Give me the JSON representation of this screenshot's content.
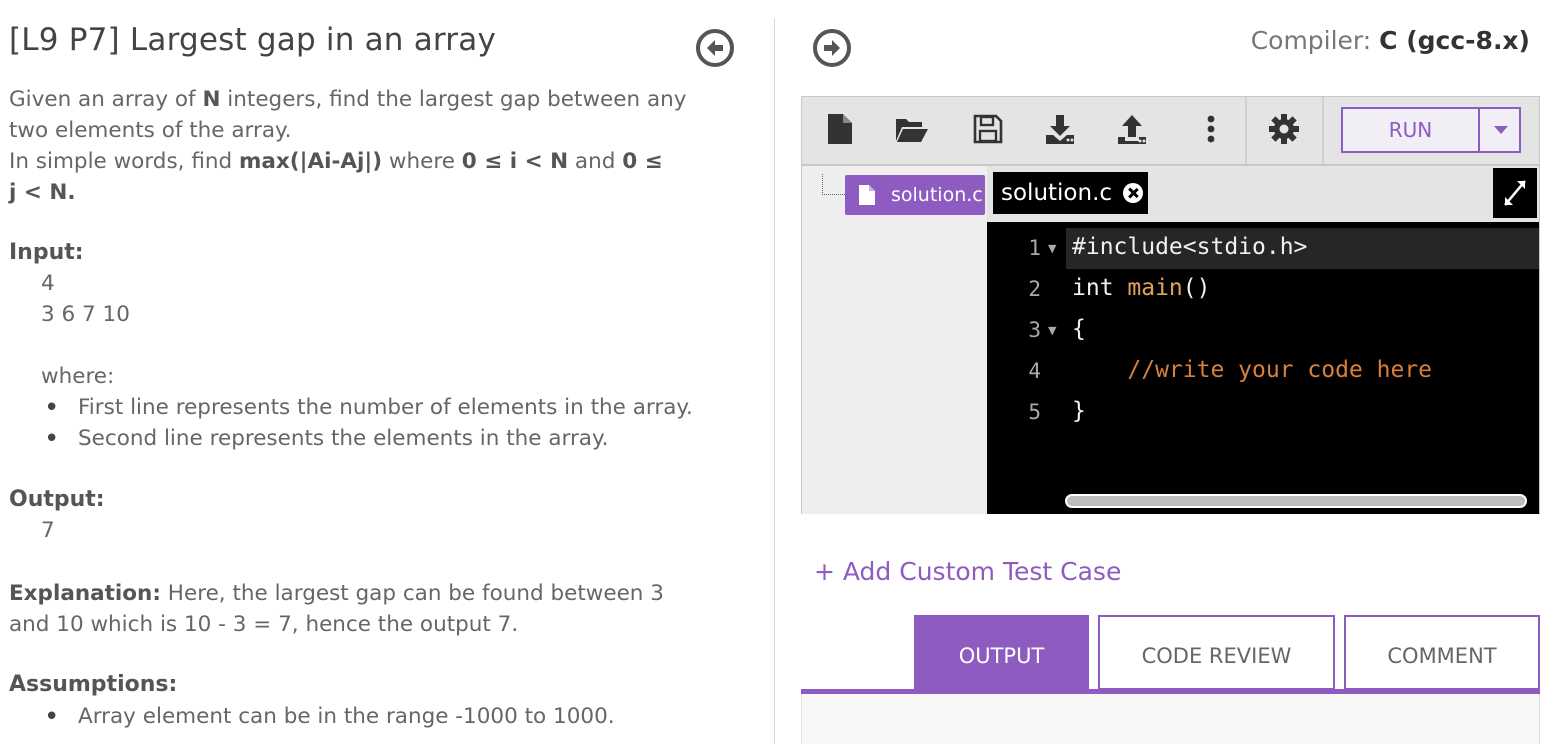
{
  "problem": {
    "title": "[L9 P7] Largest gap in an array",
    "line1_pre": "Given an array of ",
    "line1_bold": "N",
    "line1_post": " integers, find the largest gap between any",
    "line2": "two elements of the array.",
    "line3_pre": "In simple words, find ",
    "line3_bold1": "max(|Ai-Aj|)",
    "line3_mid1": " where ",
    "line3_bold2": "0 ≤ i < N",
    "line3_mid2": " and ",
    "line3_bold3": "0 ≤",
    "line4_bold": "j < N.",
    "input_heading": "Input:",
    "input_line1": "4",
    "input_line2": "3 6 7 10",
    "where_label": "where:",
    "input_bullets": [
      "First line represents the number of elements in the array.",
      "Second line represents the elements in the array."
    ],
    "output_heading": "Output:",
    "output_value": "7",
    "explanation_heading": "Explanation:",
    "explanation_line1": " Here, the largest gap can be found between 3",
    "explanation_line2": "and 10 which is 10 - 3 = 7, hence the output 7.",
    "assumptions_heading": "Assumptions:",
    "assumption_bullets": [
      "Array element can be in the range -1000 to 1000."
    ]
  },
  "compiler": {
    "label": "Compiler: ",
    "value": "C (gcc-8.x)"
  },
  "toolbar": {
    "icons": [
      "new-file-icon",
      "open-folder-icon",
      "save-icon",
      "download-icon",
      "upload-icon",
      "more-vertical-icon",
      "settings-gear-icon"
    ],
    "run_label": "RUN"
  },
  "file_tree": {
    "file_name": "solution.c"
  },
  "editor": {
    "tab_name": "solution.c",
    "lines": [
      {
        "num": "1",
        "fold": true
      },
      {
        "num": "2",
        "fold": false
      },
      {
        "num": "3",
        "fold": true
      },
      {
        "num": "4",
        "fold": false
      },
      {
        "num": "5",
        "fold": false
      }
    ],
    "code": {
      "l1": "#include<stdio.h>",
      "l2_kw": "int ",
      "l2_fn": "main",
      "l2_rest": "()",
      "l3": "{",
      "l4": "    //write your code here",
      "l5": "}"
    }
  },
  "actions": {
    "add_custom_test_case": "+ Add Custom Test Case"
  },
  "result_tabs": {
    "output": "OUTPUT",
    "code_review": "CODE REVIEW",
    "comment": "COMMENT"
  },
  "colors": {
    "accent": "#8e5cc0",
    "editor_bg": "#000000"
  }
}
